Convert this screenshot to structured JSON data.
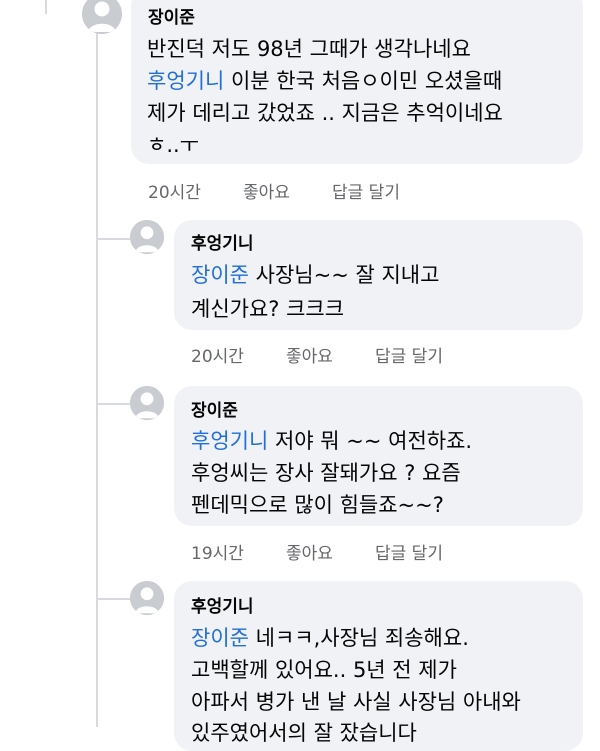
{
  "comments": [
    {
      "author": "장이준",
      "lines": [
        {
          "mention": "",
          "text": "반진덕 저도 98년 그때가  생각나네요"
        },
        {
          "mention": "후엉기니",
          "text": " 이분 한국 처음ㅇ이민 오셨을때"
        },
        {
          "mention": "",
          "text": "제가 데리고 갔었죠 .. 지금은 추억이네요"
        },
        {
          "mention": "",
          "text": "ㅎ..ㅜ"
        }
      ],
      "time": "20시간",
      "like": "좋아요",
      "reply": "답글 달기"
    },
    {
      "author": "후엉기니",
      "lines": [
        {
          "mention": "장이준",
          "text": " 사장님~~  잘 지내고"
        },
        {
          "mention": "",
          "text": "계신가요? 크크크"
        }
      ],
      "time": "20시간",
      "like": "좋아요",
      "reply": "답글 달기"
    },
    {
      "author": "장이준",
      "lines": [
        {
          "mention": "후엉기니",
          "text": " 저야 뭐 ~~ 여전하죠."
        },
        {
          "mention": "",
          "text": "후엉씨는 장사 잘돼가요 ? 요즘"
        },
        {
          "mention": "",
          "text": "펜데믹으로 많이 힘들죠~~?"
        }
      ],
      "time": "19시간",
      "like": "좋아요",
      "reply": "답글 달기"
    },
    {
      "author": "후엉기니",
      "lines": [
        {
          "mention": "장이준",
          "text": " 네ㅋㅋ,사장님 죄송해요."
        },
        {
          "mention": "",
          "text": "고백할께 있어요.. 5년 전 제가"
        },
        {
          "mention": "",
          "text": "아파서 병가 낸 날 사실 사장님 아내와"
        },
        {
          "mention": "",
          "text": "있주였어서의 잘 잤습니다"
        }
      ],
      "time": "",
      "like": "",
      "reply": ""
    }
  ]
}
